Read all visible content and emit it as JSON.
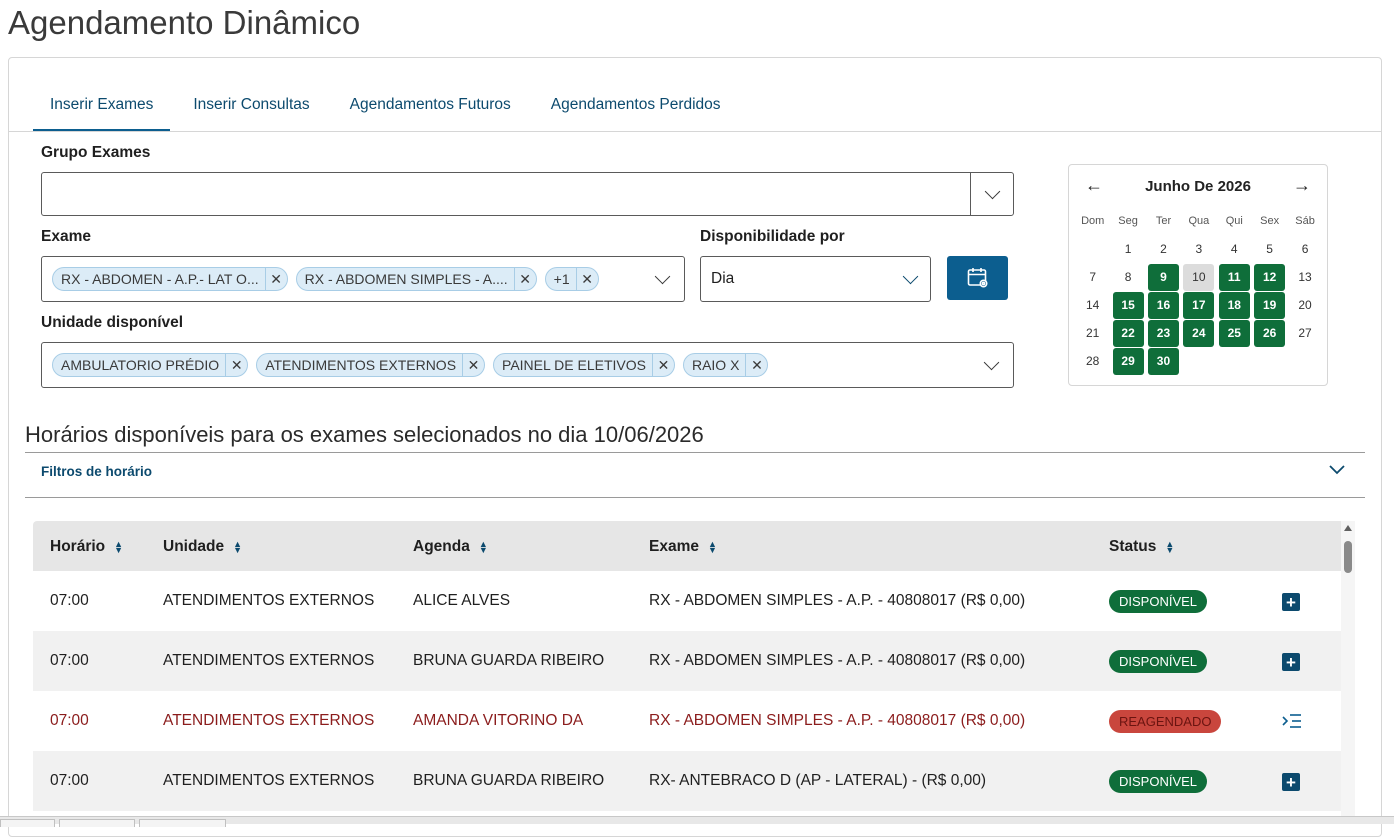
{
  "page": {
    "title": "Agendamento Dinâmico"
  },
  "tabs": [
    "Inserir Exames",
    "Inserir Consultas",
    "Agendamentos Futuros",
    "Agendamentos Perdidos"
  ],
  "form": {
    "grupo_label": "Grupo Exames",
    "grupo_value": "",
    "exame_label": "Exame",
    "exame_chips": [
      "RX - ABDOMEN - A.P.- LAT O...",
      "RX - ABDOMEN SIMPLES - A....",
      "+1"
    ],
    "disp_label": "Disponibilidade por",
    "disp_value": "Dia",
    "unidade_label": "Unidade disponível",
    "unidade_chips": [
      "AMBULATORIO PRÉDIO",
      "ATENDIMENTOS EXTERNOS",
      "PAINEL DE ELETIVOS",
      "RAIO X"
    ]
  },
  "calendar": {
    "title": "Junho De 2026",
    "prev": "←",
    "next": "→",
    "weekdays": [
      "Dom",
      "Seg",
      "Ter",
      "Qua",
      "Qui",
      "Sex",
      "Sáb"
    ],
    "weeks": [
      [
        "",
        "1",
        "2",
        "3",
        "4",
        "5",
        "6"
      ],
      [
        "7",
        "8",
        "9",
        "10",
        "11",
        "12",
        "13"
      ],
      [
        "14",
        "15",
        "16",
        "17",
        "18",
        "19",
        "20"
      ],
      [
        "21",
        "22",
        "23",
        "24",
        "25",
        "26",
        "27"
      ],
      [
        "28",
        "29",
        "30",
        "",
        "",
        "",
        ""
      ]
    ],
    "available": [
      "9",
      "11",
      "12",
      "15",
      "16",
      "17",
      "18",
      "19",
      "22",
      "23",
      "24",
      "25",
      "26",
      "29",
      "30"
    ],
    "selected": "10",
    "colors": {
      "available": "#0f6e3a",
      "selected": "#dcdcdc"
    }
  },
  "section": {
    "title": "Horários disponíveis para os exames selecionados no dia 10/06/2026",
    "filters": "Filtros de horário"
  },
  "table": {
    "headers": [
      "Horário",
      "Unidade",
      "Agenda",
      "Exame",
      "Status"
    ],
    "rows": [
      {
        "horario": "07:00",
        "unidade": "ATENDIMENTOS EXTERNOS",
        "agenda": "ALICE ALVES",
        "exame": "RX - ABDOMEN SIMPLES - A.P. - 40808017 (R$ 0,00)",
        "status": "DISPONÍVEL",
        "status_kind": "ok",
        "action": "plus-icon"
      },
      {
        "horario": "07:00",
        "unidade": "ATENDIMENTOS EXTERNOS",
        "agenda": "BRUNA GUARDA RIBEIRO",
        "exame": "RX - ABDOMEN SIMPLES - A.P. - 40808017 (R$ 0,00)",
        "status": "DISPONÍVEL",
        "status_kind": "ok",
        "action": "plus-icon"
      },
      {
        "horario": "07:00",
        "unidade": "ATENDIMENTOS EXTERNOS",
        "agenda": "AMANDA VITORINO DA",
        "exame": "RX - ABDOMEN SIMPLES - A.P. - 40808017 (R$ 0,00)",
        "status": "REAGENDADO",
        "status_kind": "re",
        "action": "list-indent-icon"
      },
      {
        "horario": "07:00",
        "unidade": "ATENDIMENTOS EXTERNOS",
        "agenda": "BRUNA GUARDA RIBEIRO",
        "exame": "RX- ANTEBRACO D (AP - LATERAL) - (R$ 0,00)",
        "status": "DISPONÍVEL",
        "status_kind": "ok",
        "action": "plus-icon"
      }
    ]
  },
  "colors": {
    "primary": "#0c5e8f",
    "link": "#0c4a6e",
    "available": "#0f6e3a",
    "rescheduled": "#c9463d",
    "rescheduled_text": "#8b1c1c"
  }
}
